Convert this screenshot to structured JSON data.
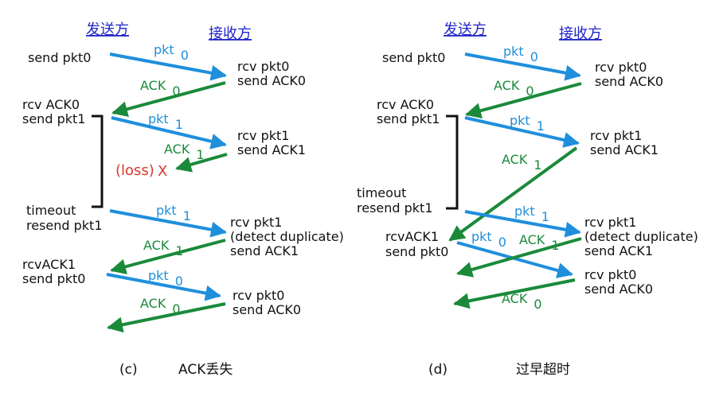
{
  "colors": {
    "data_pkt": "#1f8fdc",
    "ack": "#1a8a3a",
    "loss": "#d43a2a",
    "header": "#1f24c8",
    "text": "#111111"
  },
  "panel_c": {
    "sender_header": "发送方",
    "receiver_header": "接收方",
    "send_pkt0": "send pkt0",
    "pkt0_label": "pkt",
    "pkt0_num": "0",
    "rcv_pkt0_a": "rcv pkt0",
    "send_ack0_a": "send ACK0",
    "ack0_label": "ACK",
    "ack0_num": "0",
    "rcv_ack0": "rcv ACK0",
    "send_pkt1": "send pkt1",
    "pkt1_label": "pkt",
    "pkt1_num": "1",
    "rcv_pkt1_a": "rcv pkt1",
    "send_ack1_a": "send ACK1",
    "ack1_label": "ACK",
    "ack1_num": "1",
    "loss_text": "(loss)",
    "loss_mark": "X",
    "timeout": "timeout",
    "resend_pkt1": "resend pkt1",
    "pkt1b_label": "pkt",
    "pkt1b_num": "1",
    "rcv_pkt1_b": "rcv pkt1",
    "detect_dup": "(detect duplicate)",
    "send_ack1_b": "send ACK1",
    "ack1b_label": "ACK",
    "ack1b_num": "1",
    "rcvack1": "rcvACK1",
    "send_pkt0_b": "send pkt0",
    "pkt0b_label": "pkt",
    "pkt0b_num": "0",
    "rcv_pkt0_b": "rcv pkt0",
    "send_ack0_b": "send ACK0",
    "ack0b_label": "ACK",
    "ack0b_num": "0",
    "caption_letter": "(c)",
    "caption_text": "ACK丢失"
  },
  "panel_d": {
    "sender_header": "发送方",
    "receiver_header": "接收方",
    "send_pkt0": "send pkt0",
    "pkt0_label": "pkt",
    "pkt0_num": "0",
    "rcv_pkt0_a": "rcv pkt0",
    "send_ack0_a": "send ACK0",
    "ack0_label": "ACK",
    "ack0_num": "0",
    "rcv_ack0": "rcv ACK0",
    "send_pkt1": "send pkt1",
    "pkt1_label": "pkt",
    "pkt1_num": "1",
    "rcv_pkt1_a": "rcv pkt1",
    "send_ack1_a": "send ACK1",
    "ack1_label": "ACK",
    "ack1_num": "1",
    "timeout": "timeout",
    "resend_pkt1": "resend pkt1",
    "pkt1b_label": "pkt",
    "pkt1b_num": "1",
    "rcv_pkt1_b": "rcv pkt1",
    "detect_dup": "(detect duplicate)",
    "send_ack1_b": "send ACK1",
    "ack1b_label": "ACK",
    "ack1b_num": "1",
    "rcvack1": "rcvACK1",
    "send_pkt0_b": "send pkt0",
    "pkt0b_label": "pkt",
    "pkt0b_num": "0",
    "rcv_pkt0_b": "rcv pkt0",
    "send_ack0_b": "send ACK0",
    "ack0b_label": "ACK",
    "ack0b_num": "0",
    "caption_letter": "(d)",
    "caption_text": "过早超时"
  }
}
